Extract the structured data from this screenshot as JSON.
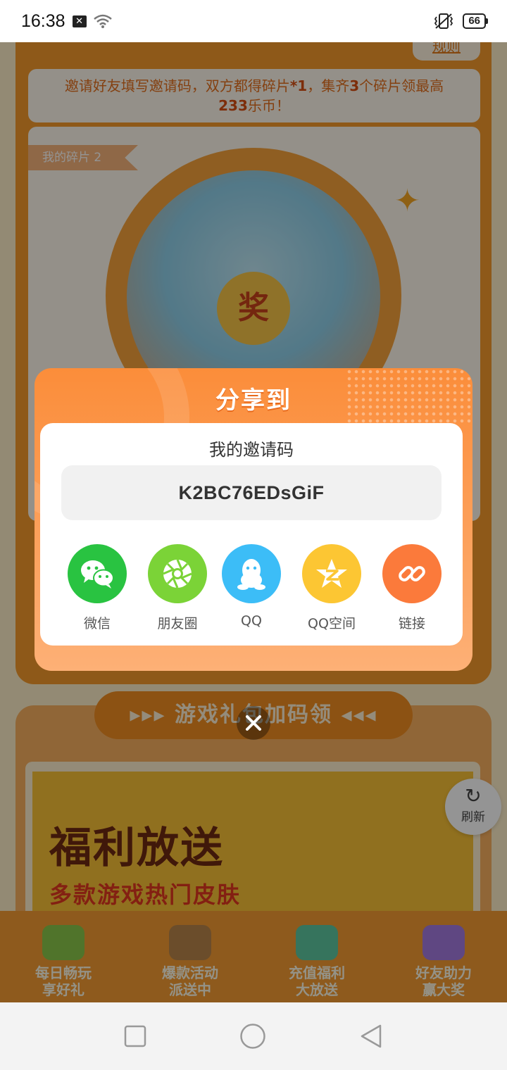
{
  "status_bar": {
    "time": "16:38",
    "battery": "66",
    "icons": [
      "notification-x-icon",
      "wifi-icon",
      "vibrate-icon",
      "battery-icon"
    ]
  },
  "background": {
    "rule_link": "规则",
    "invite_banner": {
      "part1": "邀请好友填写邀请码，双方都得碎片",
      "part2": "*1",
      "part3": "，集齐",
      "part4": "3",
      "part5": "个碎片领最高",
      "part6": "233",
      "part7": "乐币！"
    },
    "fragments_tag": "我的碎片 2",
    "prize_char": "奖",
    "section_title": "▸▸▸ 游戏礼包加码领 ◂◂◂",
    "promo_title": "福利放送",
    "promo_subtitle": "多款游戏热门皮肤",
    "refresh_label": "刷新",
    "bottom_nav": [
      {
        "line1": "每日畅玩",
        "line2": "享好礼"
      },
      {
        "line1": "爆款活动",
        "line2": "派送中"
      },
      {
        "line1": "充值福利",
        "line2": "大放送"
      },
      {
        "line1": "好友助力",
        "line2": "赢大奖"
      }
    ]
  },
  "modal": {
    "title": "分享到",
    "code_label": "我的邀请码",
    "invite_code": "K2BC76EDsGiF",
    "share_options": [
      {
        "label": "微信",
        "icon": "wechat-icon",
        "color": "#29c341"
      },
      {
        "label": "朋友圈",
        "icon": "moments-icon",
        "color": "#7bd337"
      },
      {
        "label": "QQ",
        "icon": "qq-icon",
        "color": "#3cbdf7"
      },
      {
        "label": "QQ空间",
        "icon": "qzone-icon",
        "color": "#fcc633"
      },
      {
        "label": "链接",
        "icon": "link-icon",
        "color": "#fb7a3b"
      }
    ]
  },
  "nav_bar": {
    "buttons": [
      "recent-apps-button",
      "home-button",
      "back-button"
    ]
  }
}
